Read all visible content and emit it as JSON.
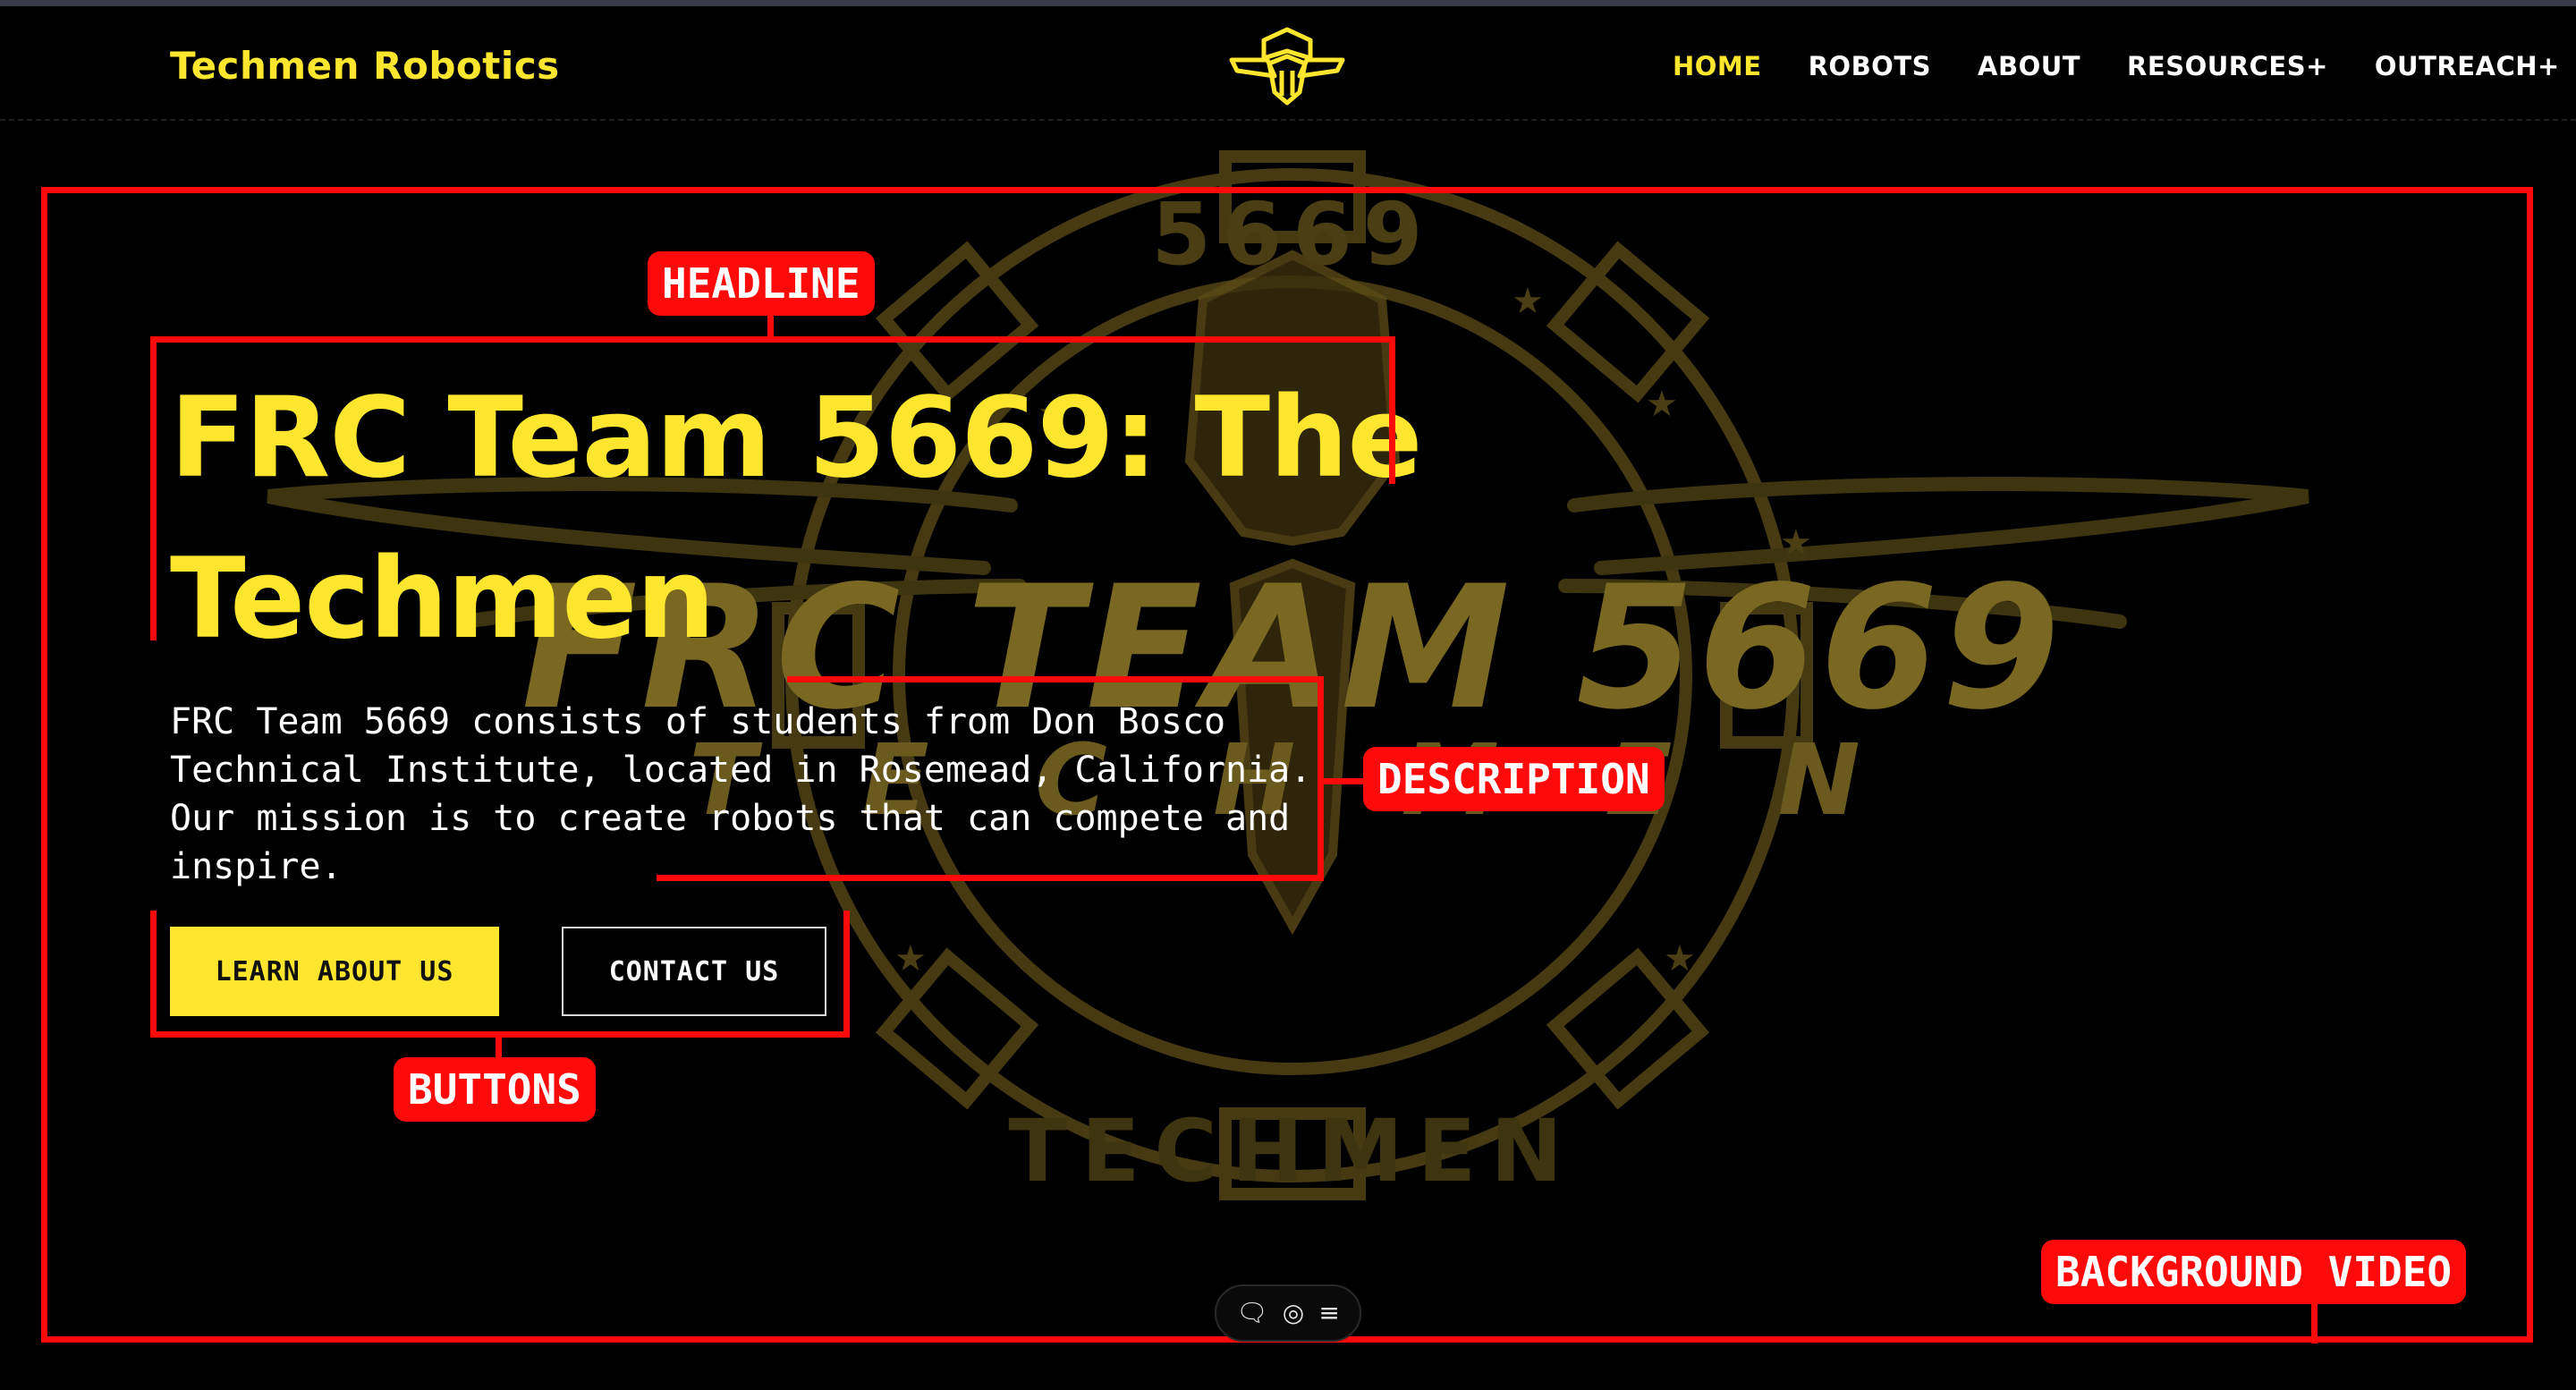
{
  "nav": {
    "brand": "Techmen Robotics",
    "links": [
      {
        "label": "HOME",
        "active": true
      },
      {
        "label": "ROBOTS",
        "active": false
      },
      {
        "label": "ABOUT",
        "active": false
      },
      {
        "label": "RESOURCES+",
        "active": false
      },
      {
        "label": "OUTREACH+",
        "active": false
      }
    ]
  },
  "hero": {
    "headline_line1": "FRC Team 5669: The",
    "headline_line2": "Techmen",
    "description": "FRC Team 5669 consists of students from Don Bosco Technical Institute, located in Rosemead, California. Our mission is to create robots that can compete and inspire.",
    "buttons": {
      "primary": "LEARN ABOUT US",
      "secondary": "CONTACT US"
    }
  },
  "background": {
    "emblem_number": "5669",
    "emblem_title": "FRC TEAM 5669",
    "emblem_subtitle": "T E C H M E N",
    "emblem_arc_text": "TECHMEN"
  },
  "annotations": {
    "headline": "HEADLINE",
    "description": "DESCRIPTION",
    "buttons": "BUTTONS",
    "background_video": "BACKGROUND VIDEO"
  },
  "floating_toolbar": {
    "icons": [
      "comment-icon",
      "eye-icon",
      "menu-icon"
    ]
  },
  "colors": {
    "accent": "#ffe62e",
    "background": "#000000",
    "annotation": "#ff0a0a",
    "emblem": "#7a6722"
  }
}
